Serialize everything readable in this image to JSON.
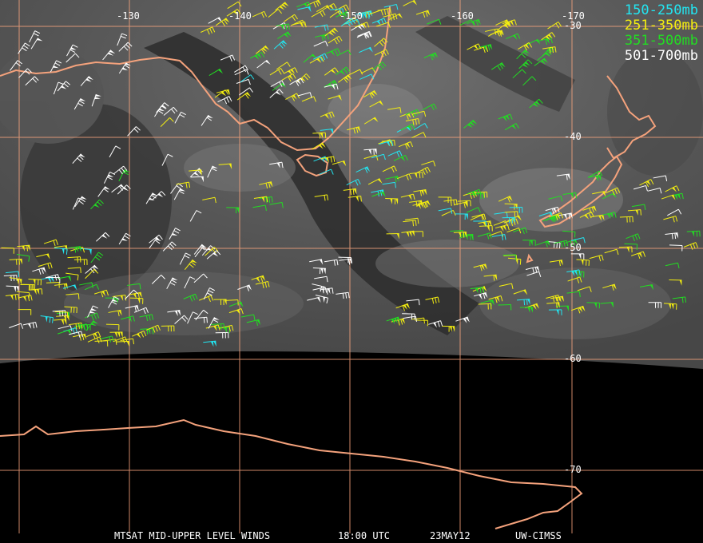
{
  "colors": {
    "gridline": "#f4a27c",
    "coastline": "#f4a27c",
    "space": "#000000",
    "wv_dark": "#3c3c3c",
    "wv_light": "#9a9a9a"
  },
  "longitude_labels": [
    "-130",
    "-140",
    "-150",
    "-160",
    "-170"
  ],
  "latitude_labels": [
    "-30",
    "-40",
    "-50",
    "-60",
    "-70"
  ],
  "legend": [
    {
      "label": "150-250mb",
      "color": "#22e6f2"
    },
    {
      "label": "251-350mb",
      "color": "#f4ee10"
    },
    {
      "label": "351-500mb",
      "color": "#22dd22"
    },
    {
      "label": "501-700mb",
      "color": "#ffffff"
    }
  ],
  "footer": {
    "product": "MTSAT MID-UPPER LEVEL WINDS",
    "time": "18:00 UTC",
    "date": "23MAY12",
    "source": "UW-CIMSS"
  },
  "layers": {
    "barbs_legend_colors": [
      "#22e6f2",
      "#f4ee10",
      "#22dd22",
      "#ffffff"
    ]
  }
}
